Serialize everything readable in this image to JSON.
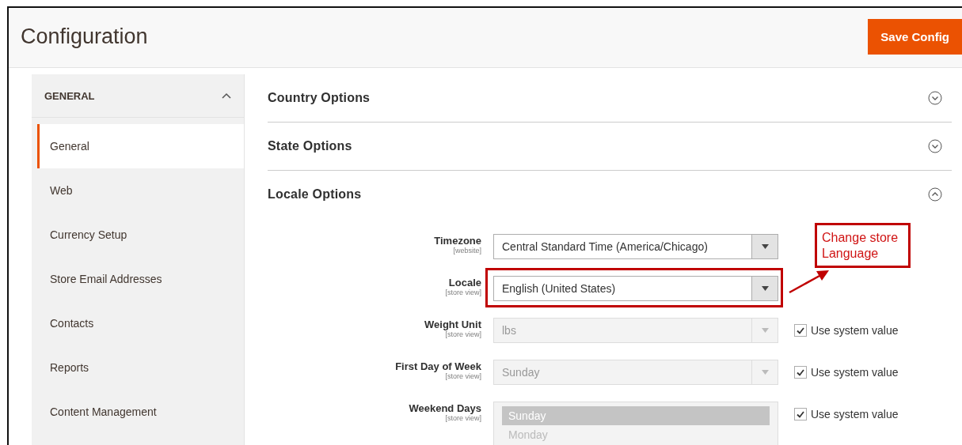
{
  "page": {
    "title": "Configuration",
    "save_button": "Save Config"
  },
  "sidebar": {
    "group": {
      "label": "GENERAL",
      "expanded": true
    },
    "items": [
      {
        "label": "General",
        "selected": true
      },
      {
        "label": "Web",
        "selected": false
      },
      {
        "label": "Currency Setup",
        "selected": false
      },
      {
        "label": "Store Email Addresses",
        "selected": false
      },
      {
        "label": "Contacts",
        "selected": false
      },
      {
        "label": "Reports",
        "selected": false
      },
      {
        "label": "Content Management",
        "selected": false
      }
    ]
  },
  "sections": [
    {
      "title": "Country Options",
      "expanded": false
    },
    {
      "title": "State Options",
      "expanded": false
    },
    {
      "title": "Locale Options",
      "expanded": true
    }
  ],
  "locale_fields": [
    {
      "kind": "select",
      "label": "Timezone",
      "scope": "[website]",
      "value": "Central Standard Time (America/Chicago)",
      "disabled": false,
      "highlighted": false
    },
    {
      "kind": "select",
      "label": "Locale",
      "scope": "[store view]",
      "value": "English (United States)",
      "disabled": false,
      "highlighted": true
    },
    {
      "kind": "select",
      "label": "Weight Unit",
      "scope": "[store view]",
      "value": "lbs",
      "disabled": true,
      "highlighted": false,
      "use_system_value": {
        "label": "Use system value",
        "checked": true
      }
    },
    {
      "kind": "select",
      "label": "First Day of Week",
      "scope": "[store view]",
      "value": "Sunday",
      "disabled": true,
      "highlighted": false,
      "use_system_value": {
        "label": "Use system value",
        "checked": true
      }
    },
    {
      "kind": "multiselect",
      "label": "Weekend Days",
      "scope": "[store view]",
      "disabled": true,
      "highlighted": false,
      "options": [
        {
          "label": "Sunday",
          "selected": true
        },
        {
          "label": "Monday",
          "selected": false
        }
      ],
      "use_system_value": {
        "label": "Use system value",
        "checked": true
      }
    }
  ],
  "annotation": {
    "text": "Change store Language"
  }
}
